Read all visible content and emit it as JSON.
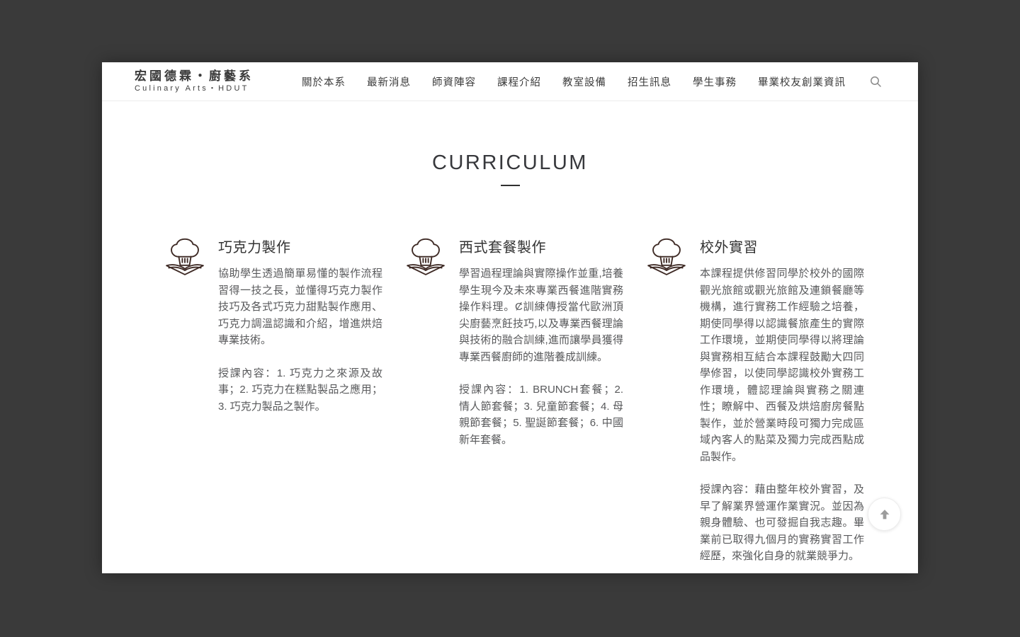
{
  "colors": {
    "outer_background": "#3a3a3a",
    "page_background": "#ffffff",
    "icon_stroke": "#3e2a25",
    "heading_text": "#37383c",
    "body_text": "#58595b",
    "back_top_arrow": "#9c9c9c"
  },
  "header": {
    "logo_title": "宏國德霖・廚藝系",
    "logo_subtitle": "Culinary Arts・HDUT",
    "nav_items": [
      "關於本系",
      "最新消息",
      "師資陣容",
      "課程介紹",
      "教室設備",
      "招生訊息",
      "學生事務",
      "畢業校友創業資訊"
    ],
    "search_icon": "magnifier-icon"
  },
  "main": {
    "section_title": "CURRICULUM",
    "columns": [
      {
        "icon": "chef-hat-book",
        "title": "巧克力製作",
        "paragraphs": [
          "協助學生透過簡單易懂的製作流程習得一技之長，並懂得巧克力製作技巧及各式巧克力甜點製作應用、巧克力調溫認識和介紹，增進烘焙專業技術。",
          "授課內容：1. 巧克力之來源及故事；2. 巧克力在糕點製品之應用；3. 巧克力製品之製作。"
        ]
      },
      {
        "icon": "chef-hat-book",
        "title": "西式套餐製作",
        "paragraphs": [
          "學習過程理論與實際操作並重,培養學生現今及未來專業西餐進階實務操作料理。Ȼ訓練傳授當代歐洲頂尖廚藝烹飪技巧,以及專業西餐理論與技術的融合訓練,進而讓學員獲得專業西餐廚師的進階養成訓練。",
          "授課內容：1. BRUNCH套餐；2. 情人節套餐；3. 兒童節套餐；4. 母親節套餐；5. 聖誕節套餐；6. 中國新年套餐。"
        ]
      },
      {
        "icon": "chef-hat-book",
        "title": "校外實習",
        "paragraphs": [
          "本課程提供修習同學於校外的國際觀光旅館或觀光旅館及連鎖餐廳等機構，進行實務工作經驗之培養，期使同學得以認識餐旅產生的實際工作環境，並期使同學得以將理論與實務相互結合本課程鼓勵大四同學修習，以使同學認識校外實務工作環境，體認理論與實務之關連性；瞭解中、西餐及烘焙廚房餐點製作，並於營業時段可獨力完成區域內客人的點菜及獨力完成西點成品製作。",
          "授課內容：藉由整年校外實習，及早了解業界營運作業實況。並因為親身體驗、也可發掘自我志趣。畢業前已取得九個月的實務實習工作經歷，來強化自身的就業競爭力。"
        ]
      }
    ]
  },
  "back_to_top": {
    "icon": "arrow-up"
  }
}
